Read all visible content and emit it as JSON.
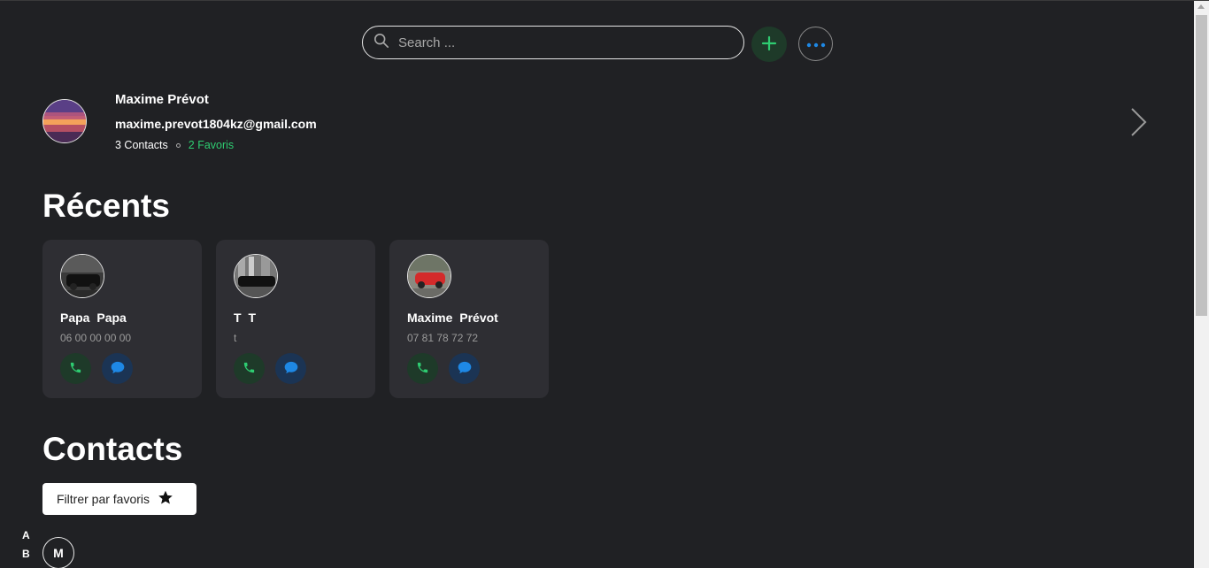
{
  "search": {
    "placeholder": "Search ..."
  },
  "profile": {
    "name": "Maxime Prévot",
    "email": "maxime.prevot1804kz@gmail.com",
    "contacts_count": "3 Contacts",
    "favorites_count": "2 Favoris"
  },
  "recents": {
    "title": "Récents",
    "cards": [
      {
        "name": "Papa  Papa",
        "phone": "06 00 00 00 00"
      },
      {
        "name": "T  T",
        "phone": "t"
      },
      {
        "name": "Maxime  Prévot",
        "phone": "07 81 78 72 72"
      }
    ]
  },
  "contacts": {
    "title": "Contacts",
    "filter_label": "Filtrer par favoris",
    "alphabet": [
      "A",
      "B"
    ],
    "first_group_letter": "M"
  },
  "colors": {
    "background": "#202124",
    "card": "#2e2e33",
    "accent_green": "#2ecc71",
    "accent_blue": "#1e88e5"
  },
  "icons": {
    "search": "search-icon",
    "add": "plus-icon",
    "more": "more-dots-icon",
    "next": "chevron-right-icon",
    "call": "phone-icon",
    "message": "chat-bubble-icon",
    "favorite": "star-icon"
  }
}
